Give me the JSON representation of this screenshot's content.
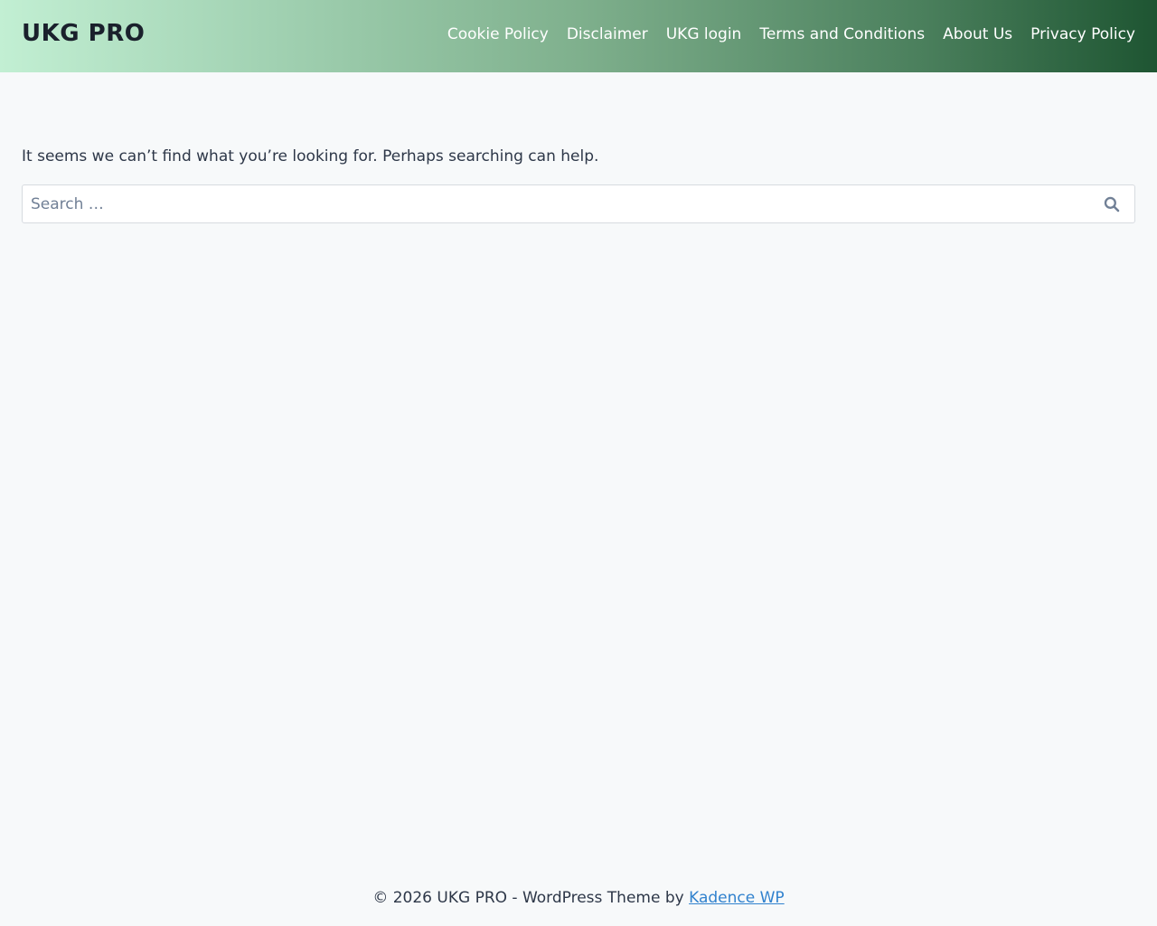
{
  "header": {
    "site_title": "UKG PRO",
    "nav": [
      {
        "label": "Cookie Policy"
      },
      {
        "label": "Disclaimer"
      },
      {
        "label": "UKG login"
      },
      {
        "label": "Terms and Conditions"
      },
      {
        "label": "About Us"
      },
      {
        "label": "Privacy Policy"
      }
    ]
  },
  "main": {
    "message": "It seems we can’t find what you’re looking for. Perhaps searching can help.",
    "search": {
      "placeholder": "Search …",
      "value": "",
      "button_icon": "search-icon"
    }
  },
  "footer": {
    "text": "© 2026 UKG PRO - WordPress Theme by ",
    "link_label": "Kadence WP"
  },
  "colors": {
    "header_gradient_start": "#c2efd3",
    "header_gradient_end": "#1e5532",
    "link": "#3182ce",
    "background": "#f7f9fa"
  }
}
